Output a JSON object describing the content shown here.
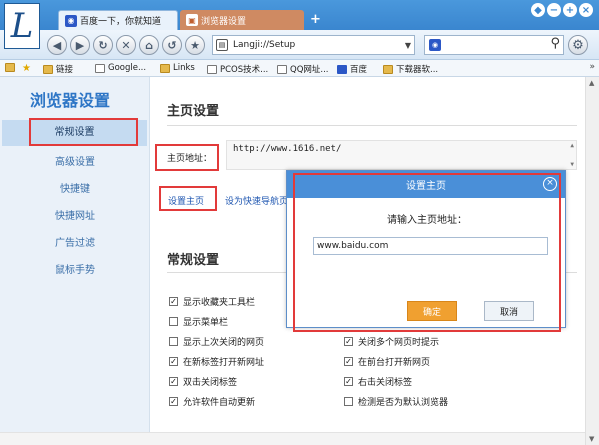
{
  "browser": {
    "logo_letter": "L",
    "tabs": [
      {
        "label": "百度一下，你就知道",
        "icon": "baidu-paw-icon"
      },
      {
        "label": "浏览器设置",
        "icon": "settings-page-icon"
      }
    ],
    "new_tab": "+",
    "window_controls": [
      "◆",
      "−",
      "+",
      "×"
    ],
    "address": "Langji://Setup",
    "bookmarks": [
      {
        "label": "链接",
        "icon": "folder-icon"
      },
      {
        "label": "Google...",
        "icon": "doc-icon"
      },
      {
        "label": "Links",
        "icon": "folder-icon"
      },
      {
        "label": "PCOS技术...",
        "icon": "doc-icon"
      },
      {
        "label": "QQ网址...",
        "icon": "doc-icon"
      },
      {
        "label": "百度",
        "icon": "baidu-paw-icon"
      },
      {
        "label": "下载器软...",
        "icon": "folder-icon"
      }
    ],
    "colors": {
      "chrome_blue": "#3a86cf",
      "tab_active": "#cf8a62",
      "accent": "#2e76c6",
      "annotation": "#e23a3a"
    }
  },
  "sidebar": {
    "title": "浏览器设置",
    "items": [
      {
        "label": "常规设置",
        "active": true
      },
      {
        "label": "高级设置"
      },
      {
        "label": "快捷键"
      },
      {
        "label": "快捷网址"
      },
      {
        "label": "广告过滤"
      },
      {
        "label": "鼠标手势"
      }
    ]
  },
  "main": {
    "home_section_title": "主页设置",
    "home_label": "主页地址：",
    "home_value": "http://www.1616.net/",
    "set_home_link": "设置主页",
    "quick_nav_link": "设为快速导航页",
    "general_section_title": "常规设置",
    "checkboxes": [
      {
        "label": "显示收藏夹工具栏",
        "checked": true
      },
      {
        "label": "显示菜单栏",
        "checked": false
      },
      {
        "label": "显示上次关闭的网页",
        "checked": false
      },
      {
        "label": "在新标签打开新网址",
        "checked": true
      },
      {
        "label": "双击关闭标签",
        "checked": true
      },
      {
        "label": "允许软件自动更新",
        "checked": true
      },
      {
        "label": "关闭多个网页时提示",
        "checked": true
      },
      {
        "label": "在前台打开新网页",
        "checked": true
      },
      {
        "label": "右击关闭标签",
        "checked": true
      },
      {
        "label": "检测是否为默认浏览器",
        "checked": false
      }
    ]
  },
  "dialog": {
    "title": "设置主页",
    "prompt": "请输入主页地址：",
    "input_value": "www.baidu.com",
    "ok_label": "确定",
    "cancel_label": "取消"
  }
}
